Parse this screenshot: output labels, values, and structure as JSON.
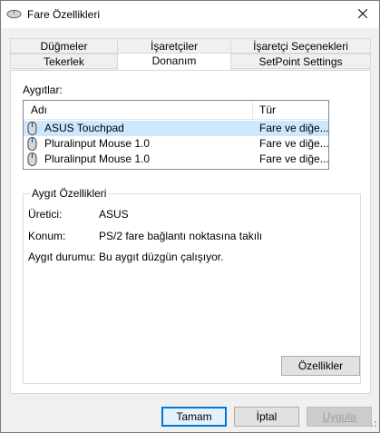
{
  "window": {
    "title": "Fare Özellikleri"
  },
  "tabs": {
    "row1": [
      "Düğmeler",
      "İşaretçiler",
      "İşaretçi Seçenekleri"
    ],
    "row2": [
      "Tekerlek",
      "Donanım",
      "SetPoint Settings"
    ],
    "active": "Donanım"
  },
  "devices": {
    "label": "Aygıtlar:",
    "columns": {
      "name": "Adı",
      "type": "Tür"
    },
    "rows": [
      {
        "name": "ASUS Touchpad",
        "type": "Fare ve diğe...",
        "selected": true
      },
      {
        "name": "Pluralinput Mouse 1.0",
        "type": "Fare ve diğe...",
        "selected": false
      },
      {
        "name": "Pluralinput Mouse 1.0",
        "type": "Fare ve diğe...",
        "selected": false
      }
    ]
  },
  "properties": {
    "title": "Aygıt Özellikleri",
    "manufacturer_label": "Üretici:",
    "manufacturer_value": "ASUS",
    "location_label": "Konum:",
    "location_value": "PS/2 fare bağlantı noktasına takılı",
    "status_label": "Aygıt durumu:",
    "status_value": "Bu aygıt düzgün çalışıyor.",
    "properties_button": "Özellikler"
  },
  "buttons": {
    "ok": "Tamam",
    "cancel": "İptal",
    "apply": "Uygula"
  },
  "colors": {
    "selection": "#cce8ff",
    "default_button_border": "#0078d7"
  }
}
